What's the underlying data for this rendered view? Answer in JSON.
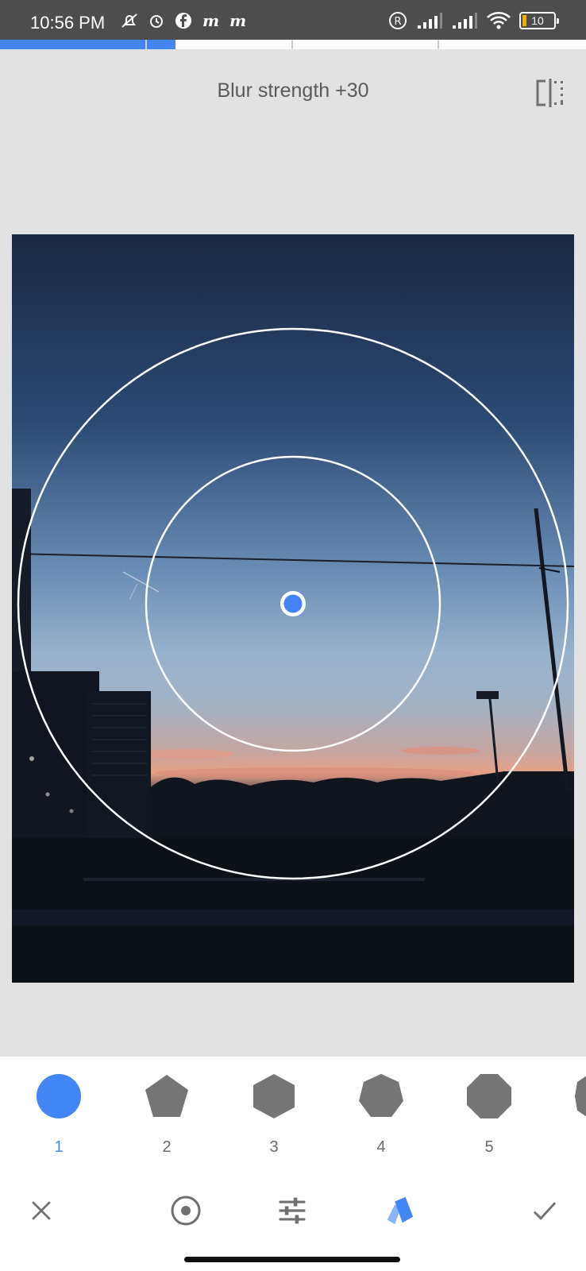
{
  "status_bar": {
    "time": "10:56 PM",
    "battery": "10",
    "icons_left": [
      "mute-icon",
      "alarm-icon",
      "facebook-icon",
      "m-app-icon",
      "m-app-icon"
    ],
    "icons_right": [
      "registered-icon",
      "signal-icon",
      "signal-icon",
      "wifi-icon",
      "battery-icon"
    ]
  },
  "progress": {
    "active_segment": 1,
    "segments": 4
  },
  "header": {
    "title": "Blur strength +30",
    "compare_icon": "compare-icon"
  },
  "photo": {
    "description_icon": "focus-center-handle"
  },
  "shapes": [
    {
      "label": "1",
      "shape": "circle",
      "active": true
    },
    {
      "label": "2",
      "shape": "pentagon",
      "active": false
    },
    {
      "label": "3",
      "shape": "hexagon",
      "active": false
    },
    {
      "label": "4",
      "shape": "heptagon",
      "active": false
    },
    {
      "label": "5",
      "shape": "octagon",
      "active": false
    }
  ],
  "toolbar": {
    "cancel": "close-icon",
    "center": "radio-target-icon",
    "adjust": "tune-icon",
    "style": "style-cards-icon",
    "apply": "check-icon"
  },
  "colors": {
    "accent": "#4285f4",
    "shape": "#757575"
  }
}
